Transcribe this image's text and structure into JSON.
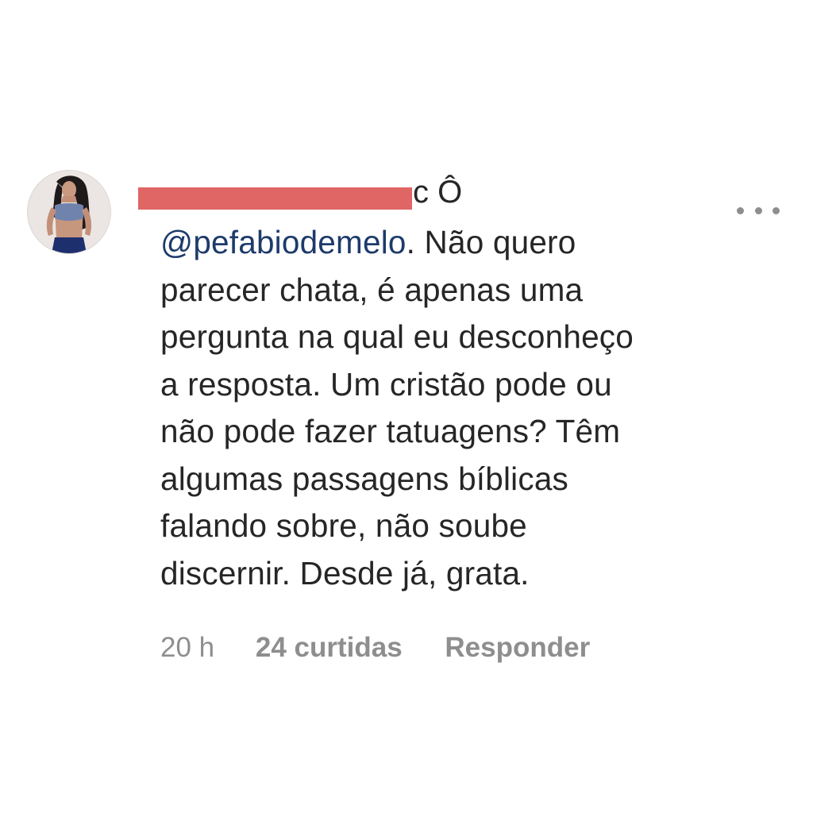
{
  "comment": {
    "avatar_icon": "profile-photo-avatar",
    "username_suffix": "c Ô",
    "mention": "@pefabiodemelo",
    "lines": [
      ". Não quero",
      "parecer chata, é apenas uma",
      "pergunta na qual eu desconheço",
      "a resposta. Um cristão pode ou",
      "não pode fazer tatuagens? Têm",
      "algumas passagens bíblicas",
      "falando sobre, não soube",
      "discernir. Desde já, grata."
    ],
    "more_icon": "ellipsis-icon",
    "time": "20 h",
    "likes": "24 curtidas",
    "reply": "Responder",
    "colors": {
      "text": "#262626",
      "mention": "#1d3b6b",
      "meta": "#8e8e8e",
      "redaction": "#e06666"
    }
  }
}
